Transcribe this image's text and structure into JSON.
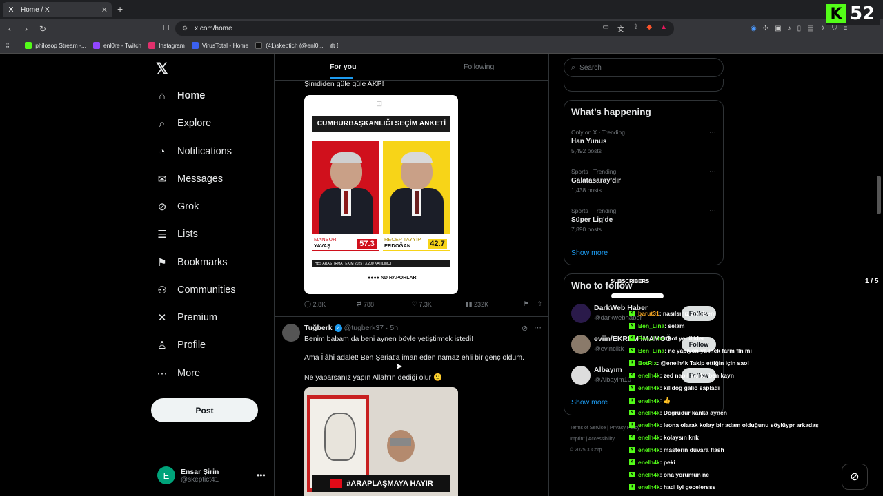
{
  "browser": {
    "tab_title": "Home / X",
    "tab_close": "✕",
    "new_tab": "+",
    "url": "x.com/home",
    "overlay_counter": "52",
    "bookmarks": [
      {
        "label": "philosop Stream -...",
        "color": "#53fc18"
      },
      {
        "label": "enl0re - Twitch",
        "color": "#9146ff"
      },
      {
        "label": "Instagram",
        "color": "#e1306c"
      },
      {
        "label": "VirusTotal - Home",
        "color": "#3b61f0"
      },
      {
        "label": "(41)skeptich (@enl0...",
        "color": "#111111"
      }
    ]
  },
  "sidebar": {
    "items": [
      {
        "label": "Home",
        "icon": "home-icon",
        "glyph": "⌂"
      },
      {
        "label": "Explore",
        "icon": "search-icon",
        "glyph": "⌕"
      },
      {
        "label": "Notifications",
        "icon": "bell-icon",
        "glyph": "♫"
      },
      {
        "label": "Messages",
        "icon": "mail-icon",
        "glyph": "✉"
      },
      {
        "label": "Grok",
        "icon": "grok-icon",
        "glyph": "⊘"
      },
      {
        "label": "Lists",
        "icon": "list-icon",
        "glyph": "☰"
      },
      {
        "label": "Bookmarks",
        "icon": "bookmark-icon",
        "glyph": "⚑"
      },
      {
        "label": "Communities",
        "icon": "communities-icon",
        "glyph": "⚇"
      },
      {
        "label": "Premium",
        "icon": "x-premium-icon",
        "glyph": "✕"
      },
      {
        "label": "Profile",
        "icon": "person-icon",
        "glyph": "♙"
      },
      {
        "label": "More",
        "icon": "more-circle-icon",
        "glyph": "⋯"
      }
    ],
    "post_label": "Post",
    "user": {
      "initial": "E",
      "name": "Ensar Şirin",
      "handle": "@skeptict41"
    }
  },
  "feed": {
    "tabs": [
      "For you",
      "Following"
    ],
    "tweet1": {
      "text": "Şimdiden güle güle AKP!",
      "poll": {
        "title": "CUMHURBAŞKANLIĞI SEÇİM ANKETİ",
        "left": {
          "first": "MANSUR",
          "last": "YAVAŞ",
          "pct": "57.3"
        },
        "right": {
          "first": "RECEP TAYYİP",
          "last": "ERDOĞAN",
          "pct": "42.7"
        },
        "footer": "HBS ARAŞTIRMA | EKİM 2025 | 3.200 KATILIMCI",
        "logo": "●●●● ND RAPORLAR"
      },
      "stats": {
        "replies": "2.8K",
        "reposts": "788",
        "likes": "7.3K",
        "views": "232K"
      }
    },
    "tweet2": {
      "name": "Tuğberk",
      "handle": "@tugberk37",
      "time": "· 5h",
      "line1": "Benim babam da beni aynen böyle yetiştirmek istedi!",
      "line2": "Ama İlâhî adalet! Ben Şeriat'a iman eden namaz ehli bir genç oldum.",
      "line3": "Ne yaparsanız yapın Allah'ın dediği olur 🙂",
      "banner": "#ARAPLAŞMAYA HAYIR"
    }
  },
  "right": {
    "search_placeholder": "Search",
    "happening_title": "What’s happening",
    "trends": [
      {
        "meta": "Only on X · Trending",
        "name": "Han Yunus",
        "posts": "5,492 posts"
      },
      {
        "meta": "Sports · Trending",
        "name": "Galatasaray'dır",
        "posts": "1,438 posts"
      },
      {
        "meta": "Sports · Trending",
        "name": "Süper Lig'de",
        "posts": "7,890 posts"
      }
    ],
    "show_more": "Show more",
    "who_title": "Who to follow",
    "follow": [
      {
        "name": "DarkWeb Haber",
        "handle": "@darkwebhaber",
        "color": "#2a1a4a"
      },
      {
        "name": "eviin/EKREM İMAMOĞ",
        "handle": "@evincikk",
        "color": "#8a7a6a"
      },
      {
        "name": "Albayım",
        "handle": "@Albayim10",
        "color": "#dddddd"
      }
    ],
    "follow_label": "Follow",
    "footer": "Terms of Service   |   Privacy Policy\nImprint   |   Accessibility\n© 2025 X Corp."
  },
  "overlay": {
    "subscribers_label": "SUBSCRIBERS",
    "page": "1 / 5",
    "chat": [
      {
        "user": "barut31",
        "msg": ": nasılsınız ziyniseni",
        "color": "#f5a623"
      },
      {
        "user": "Ben_Lina",
        "msg": ": selam",
        "color": "#53fc18"
      },
      {
        "user": "Ben_Lina",
        "msg": ": bot yenilikler",
        "color": "#53fc18"
      },
      {
        "user": "Ben_Lina",
        "msg": ": ne yapıyon ya inek farm fln mı",
        "color": "#53fc18"
      },
      {
        "user": "BotRix",
        "msg": ": @enelh4k Takip ettiğin için saol",
        "color": "#53fc18"
      },
      {
        "user": "enelh4k",
        "msg": ": zed napıl kanka ben kayn",
        "color": "#53fc18"
      },
      {
        "user": "enelh4k",
        "msg": ": killdog galio sapladı",
        "color": "#53fc18"
      },
      {
        "user": "enelh4k",
        "msg": ": 👍",
        "color": "#53fc18"
      },
      {
        "user": "enelh4k",
        "msg": ": Doğrudur kanka aynen",
        "color": "#53fc18"
      },
      {
        "user": "enelh4k",
        "msg": ": leona olarak kolay bir adam olduğunu söylüypr arkadaş",
        "color": "#53fc18"
      },
      {
        "user": "enelh4k",
        "msg": ": kolaysın knk",
        "color": "#53fc18"
      },
      {
        "user": "enelh4k",
        "msg": ": masterın duvara flash",
        "color": "#53fc18"
      },
      {
        "user": "enelh4k",
        "msg": ": peki",
        "color": "#53fc18"
      },
      {
        "user": "enelh4k",
        "msg": ": ona yorumun ne",
        "color": "#53fc18"
      },
      {
        "user": "enelh4k",
        "msg": ": hadi iyi gecelersss",
        "color": "#53fc18"
      }
    ]
  }
}
